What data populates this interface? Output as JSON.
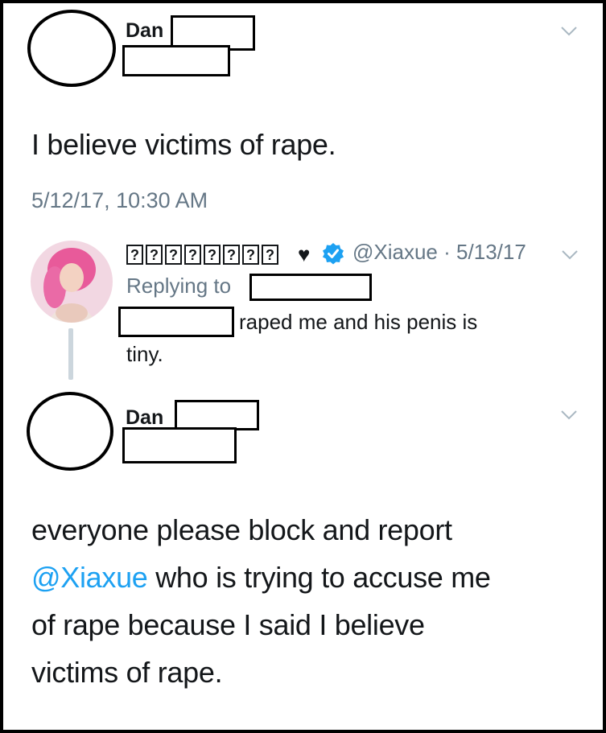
{
  "tweet1": {
    "author_first": "Dan",
    "text": "I believe victims of rape.",
    "timestamp": "5/12/17, 10:30 AM"
  },
  "reply": {
    "display_name_glyphs": [
      "?",
      "?",
      "?",
      "?",
      "?",
      "?",
      "?",
      "?"
    ],
    "heart_glyph": "♥",
    "handle": "@Xiaxue",
    "separator": "·",
    "date": "5/13/17",
    "replying_to": "Replying to",
    "text_line1": "raped me and his penis is",
    "text_line2": "tiny."
  },
  "tweet2": {
    "author_first": "Dan",
    "text_line1": "everyone please block and report",
    "mention": "@Xiaxue",
    "text_line2_rest": " who is trying to accuse me",
    "text_line3": "of rape because I said I believe",
    "text_line4": "victims of rape."
  },
  "colors": {
    "text": "#14171a",
    "muted": "#657786",
    "link": "#1da1f2",
    "verified": "#1da1f2",
    "thread_line": "#ccd6dd"
  },
  "icons": [
    "chevron-down-icon",
    "verified-badge-icon",
    "heart-icon"
  ]
}
